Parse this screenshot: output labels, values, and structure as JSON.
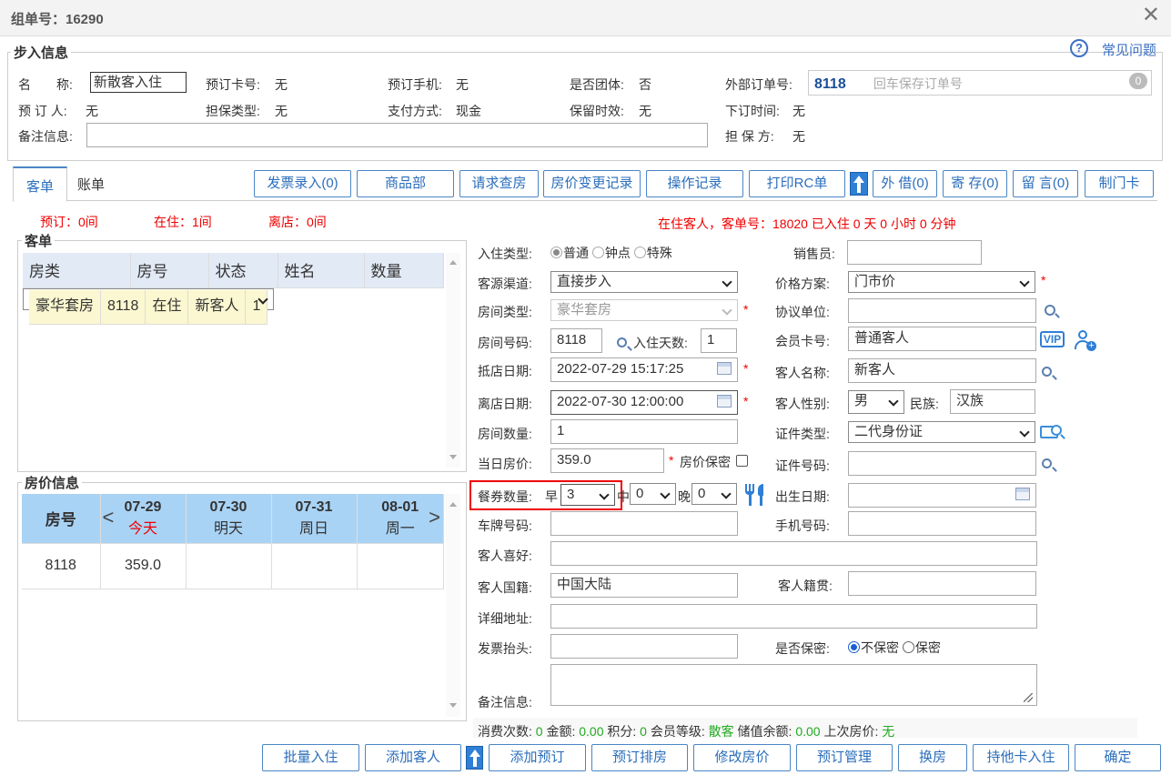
{
  "window": {
    "title": "组单号：16290"
  },
  "walkin": {
    "legend": "步入信息",
    "help": "常见问题",
    "name_label": "名　　称:",
    "name_value": "新散客入住",
    "card_label": "预订卡号:",
    "card_value": "无",
    "phone_label": "预订手机:",
    "phone_value": "无",
    "group_label": "是否团体:",
    "group_value": "否",
    "ext_label": "外部订单号:",
    "ext_value": "8118",
    "ext_placeholder": "回车保存订单号",
    "ext_badge": "0",
    "booker_label": "预 订 人:",
    "booker_value": "无",
    "guarantee_type_label": "担保类型:",
    "guarantee_type_value": "无",
    "pay_label": "支付方式:",
    "pay_value": "现金",
    "hold_label": "保留时效:",
    "hold_value": "无",
    "order_time_label": "下订时间:",
    "order_time_value": "无",
    "remark_label": "备注信息:",
    "guarantor_label": "担 保 方:",
    "guarantor_value": "无"
  },
  "tabs": [
    {
      "label": "客单"
    },
    {
      "label": "账单"
    }
  ],
  "toolbar": [
    "发票录入(0)",
    "商品部",
    "请求查房",
    "房价变更记录",
    "操作记录",
    "打印RC单",
    "外 借(0)",
    "寄 存(0)",
    "留 言(0)",
    "制门卡"
  ],
  "stats": {
    "reserved": "预订：0间",
    "inhouse": "在住：1间",
    "departed": "离店：0间"
  },
  "status_line": "在住客人，客单号：18020 已入住 0 天 0 小时 0 分钟",
  "guest_list": {
    "legend": "客单",
    "columns": [
      "房类",
      "房号",
      "状态",
      "姓名",
      "数量"
    ],
    "rows": [
      [
        "豪华套房",
        "8118",
        "在住",
        "新客人",
        "1"
      ]
    ]
  },
  "price_info": {
    "legend": "房价信息",
    "room_col": "房号",
    "days": [
      {
        "date": "07-29",
        "day": "今天"
      },
      {
        "date": "07-30",
        "day": "明天"
      },
      {
        "date": "07-31",
        "day": "周日"
      },
      {
        "date": "08-01",
        "day": "周一"
      }
    ],
    "rows": [
      {
        "room": "8118",
        "prices": [
          "359.0",
          "",
          "",
          ""
        ]
      }
    ]
  },
  "form": {
    "checkin_type_label": "入住类型:",
    "type_opts": [
      "普通",
      "钟点",
      "特殊"
    ],
    "sales_label": "销售员:",
    "source_label": "客源渠道:",
    "source_value": "直接步入",
    "plan_label": "价格方案:",
    "plan_value": "门市价",
    "roomtype_label": "房间类型:",
    "roomtype_value": "豪华套房",
    "agreement_label": "协议单位:",
    "roomno_label": "房间号码:",
    "roomno_value": "8118",
    "days_label": "入住天数:",
    "days_value": "1",
    "member_label": "会员卡号:",
    "member_value": "普通客人",
    "arrive_label": "抵店日期:",
    "arrive_value": "2022-07-29 15:17:25",
    "guestname_label": "客人名称:",
    "guestname_value": "新客人",
    "depart_label": "离店日期:",
    "depart_value": "2022-07-30 12:00:00",
    "gender_label": "客人性别:",
    "gender_value": "男",
    "nation_label": "民族:",
    "nation_value": "汉族",
    "rooms_label": "房间数量:",
    "rooms_value": "1",
    "idtype_label": "证件类型:",
    "idtype_value": "二代身份证",
    "rate_label": "当日房价:",
    "rate_value": "359.0",
    "rate_secret": "房价保密",
    "idno_label": "证件号码:",
    "meal_label": "餐券数量:",
    "breakfast_label": "早",
    "breakfast_value": "3",
    "lunch_label": "中",
    "lunch_value": "0",
    "dinner_label": "晚",
    "dinner_value": "0",
    "birth_label": "出生日期:",
    "plate_label": "车牌号码:",
    "mobile_label": "手机号码:",
    "hobby_label": "客人喜好:",
    "country_label": "客人国籍:",
    "country_value": "中国大陆",
    "origin_label": "客人籍贯:",
    "address_label": "详细地址:",
    "invoice_label": "发票抬头:",
    "secret_label": "是否保密:",
    "secret_opts": [
      "不保密",
      "保密"
    ],
    "remark_label": "备注信息:",
    "summary": {
      "visits_label": "消费次数:",
      "visits": "0",
      "amount_label": "金额:",
      "amount": "0.00",
      "points_label": "积分:",
      "points": "0",
      "level_label": "会员等级:",
      "level": "散客",
      "balance_label": "储值余额:",
      "balance": "0.00",
      "last_label": "上次房价:",
      "last": "无"
    }
  },
  "bottom": [
    "批量入住",
    "添加客人",
    "添加预订",
    "预订排房",
    "修改房价",
    "预订管理",
    "换房",
    "持他卡入住",
    "确定"
  ],
  "colors": {
    "accent": "#2a6ebb",
    "red": "#e00000",
    "highlight_box": "#e00000"
  }
}
